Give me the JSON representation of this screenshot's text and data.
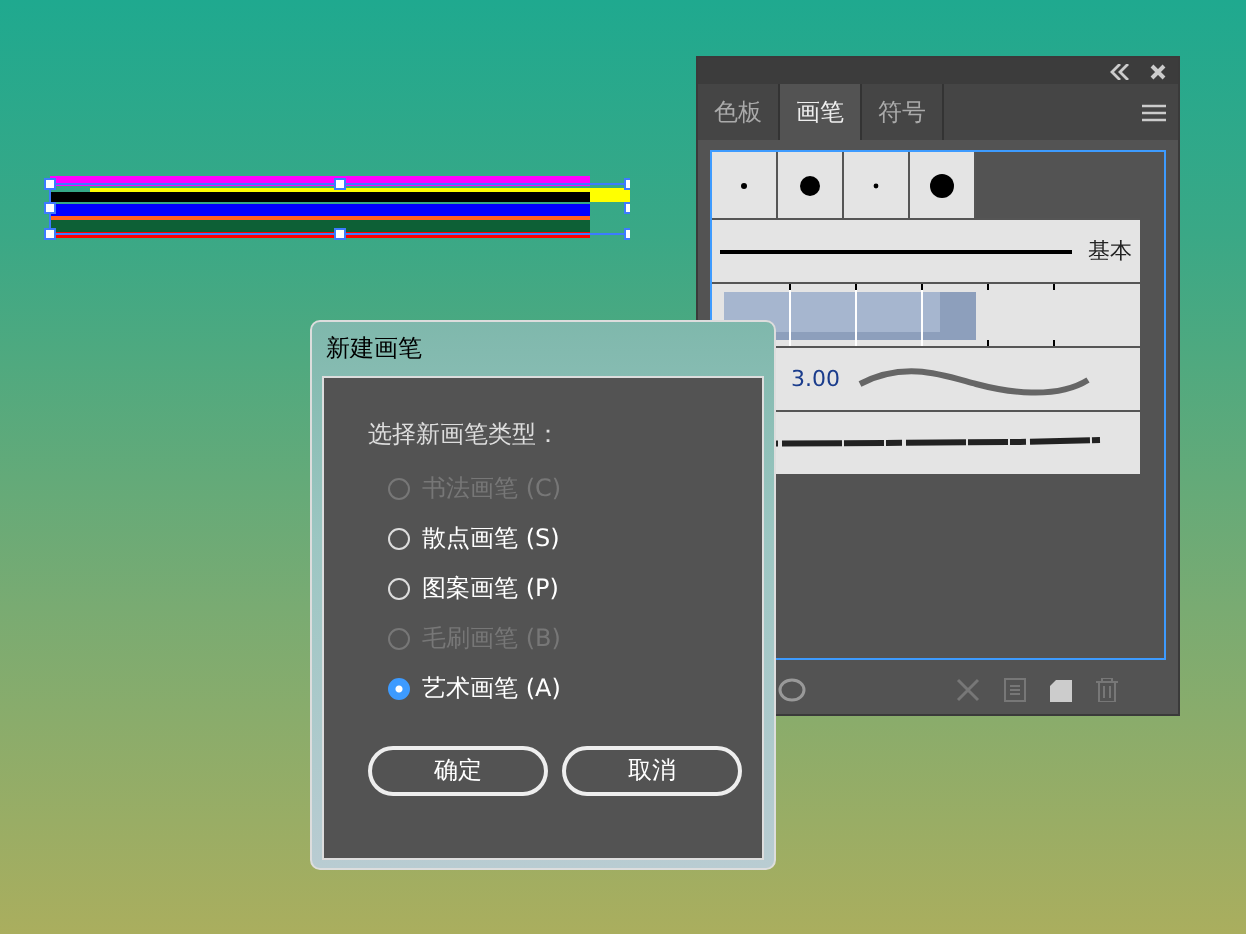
{
  "brushes_panel": {
    "tabs": [
      {
        "label": "色板",
        "selected": false
      },
      {
        "label": "画笔",
        "selected": true
      },
      {
        "label": "符号",
        "selected": false
      }
    ],
    "brushes": [
      {
        "kind": "dots"
      },
      {
        "kind": "basic",
        "label": "基本"
      },
      {
        "kind": "pattern"
      },
      {
        "kind": "wave",
        "value": "3.00"
      },
      {
        "kind": "charcoal"
      }
    ]
  },
  "dialog": {
    "title": "新建画笔",
    "prompt": "选择新画笔类型：",
    "options": [
      {
        "label": "书法画笔 (C)",
        "disabled": true,
        "selected": false
      },
      {
        "label": "散点画笔 (S)",
        "disabled": false,
        "selected": false
      },
      {
        "label": "图案画笔 (P)",
        "disabled": false,
        "selected": false
      },
      {
        "label": "毛刷画笔 (B)",
        "disabled": true,
        "selected": false
      },
      {
        "label": "艺术画笔 (A)",
        "disabled": false,
        "selected": true
      }
    ],
    "buttons": [
      "确定",
      "取消"
    ]
  }
}
